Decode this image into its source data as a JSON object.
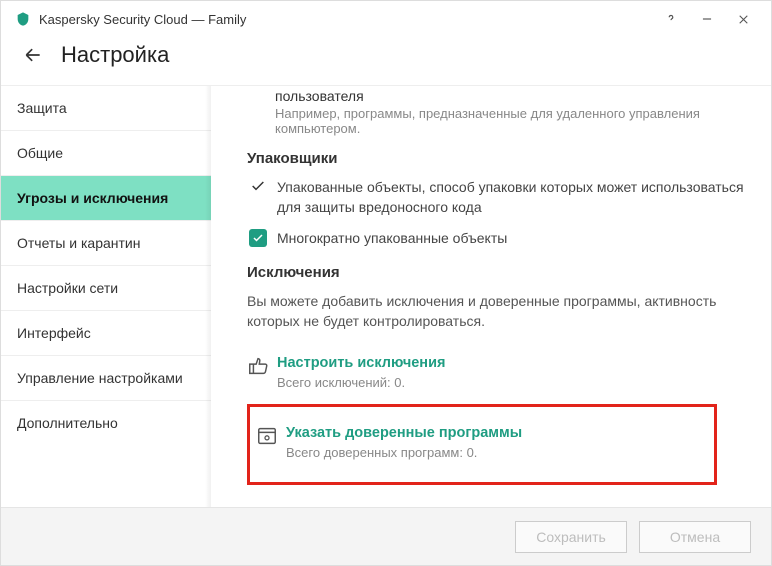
{
  "window": {
    "title": "Kaspersky Security Cloud — Family"
  },
  "header": {
    "title": "Настройка"
  },
  "sidebar": {
    "items": [
      {
        "label": "Защита",
        "active": false
      },
      {
        "label": "Общие",
        "active": false
      },
      {
        "label": "Угрозы и исключения",
        "active": true
      },
      {
        "label": "Отчеты и карантин",
        "active": false
      },
      {
        "label": "Настройки сети",
        "active": false
      },
      {
        "label": "Интерфейс",
        "active": false
      },
      {
        "label": "Управление настройками",
        "active": false
      },
      {
        "label": "Дополнительно",
        "active": false
      }
    ]
  },
  "content": {
    "user_block": {
      "title": "пользователя",
      "desc": "Например, программы, предназначенные для удаленного управления компьютером."
    },
    "packers": {
      "heading": "Упаковщики",
      "item1": "Упакованные объекты, способ упаковки которых может использоваться для защиты вредоносного кода",
      "item2": "Многократно упакованные объекты"
    },
    "exclusions": {
      "heading": "Исключения",
      "desc": "Вы можете добавить исключения и доверенные программы, активность которых не будет контролироваться.",
      "configure": {
        "label": "Настроить исключения",
        "meta": "Всего исключений: 0."
      },
      "trusted": {
        "label": "Указать доверенные программы",
        "meta": "Всего доверенных программ: 0."
      }
    }
  },
  "footer": {
    "save": "Сохранить",
    "cancel": "Отмена"
  }
}
